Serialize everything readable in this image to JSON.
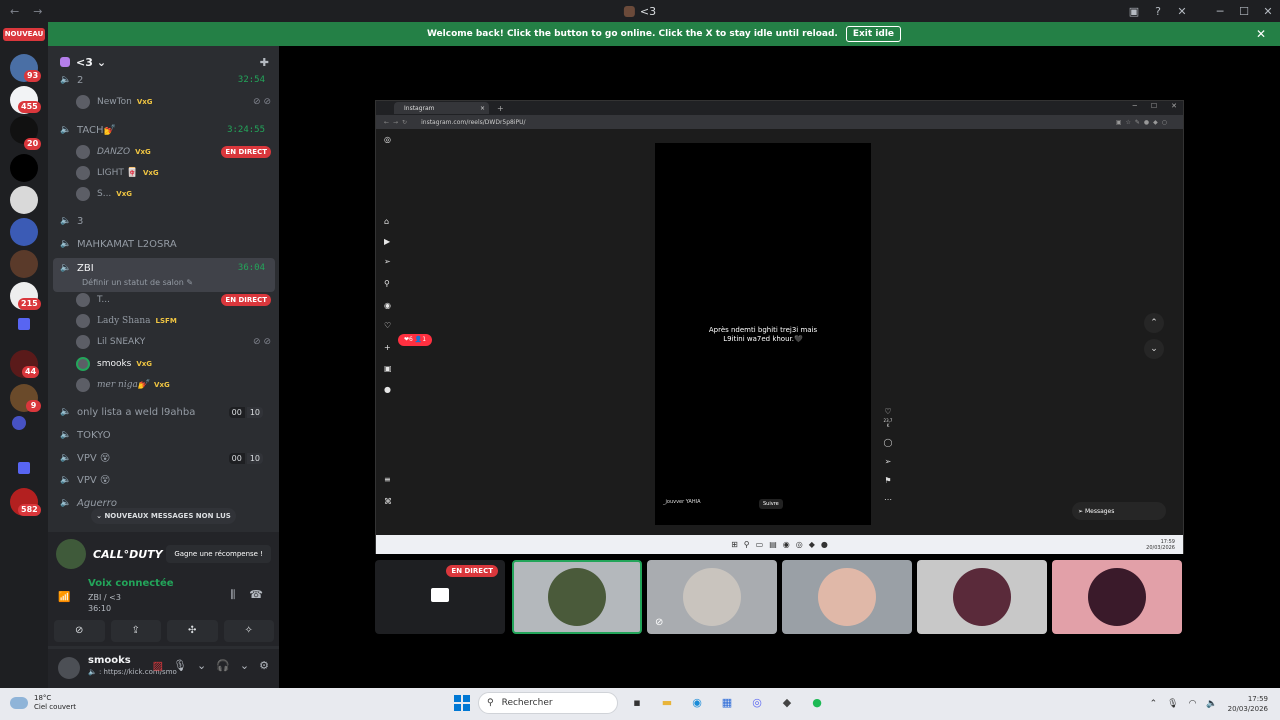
{
  "titlebar": {
    "back": "←",
    "forward": "→",
    "title": "<3",
    "icons": [
      "cast-icon",
      "help-icon",
      "tools-icon"
    ],
    "minimize": "─",
    "maximize": "☐",
    "close": "✕"
  },
  "banner": {
    "text": "Welcome back! Click the button to go online. Click the X to stay idle until reload.",
    "button": "Exit idle",
    "close": "✕"
  },
  "serverbar": {
    "nouveau": "NOUVEAU",
    "badges": [
      "93",
      "455",
      "20",
      "215",
      "44",
      "9",
      "582"
    ]
  },
  "server": {
    "name": "<3",
    "chevron": "⌄"
  },
  "channels": {
    "c1": {
      "name": "2",
      "time": "32:54"
    },
    "u_newton": {
      "name": "NewTon",
      "tag": "VxG"
    },
    "c_tach": {
      "name": "TACH💅",
      "time": "3:24:55"
    },
    "u_danzo": {
      "name": "DANZO",
      "tag": "VxG",
      "live": "EN DIRECT"
    },
    "u_light": {
      "name": "LIGHT 🀄",
      "tag": "VxG"
    },
    "u_s": {
      "name": "S...",
      "tag": "VxG"
    },
    "c3": {
      "name": "3"
    },
    "c_mahk": {
      "name": "MAHKAMAT L2OSRA"
    },
    "c_zbi": {
      "name": "ZBI",
      "time": "36:04",
      "status": "Définir un statut de salon ✎"
    },
    "u_t": {
      "name": "T...",
      "live": "EN DIRECT"
    },
    "u_lady": {
      "name": "Lady Shana",
      "tag": "LSFM"
    },
    "u_lil": {
      "name": "Lil SNEAKY"
    },
    "u_smooks": {
      "name": "smooks",
      "tag": "VxG"
    },
    "u_mer": {
      "name": "mer nigа💅",
      "tag": "VxG"
    },
    "c_only": {
      "name": "only lista a weld l9ahba",
      "a": "00",
      "b": "10"
    },
    "c_tokyo": {
      "name": "TOKYO"
    },
    "c_vpv1": {
      "name": "VPV 😵",
      "a": "00",
      "b": "10"
    },
    "c_vpv2": {
      "name": "VPV 😵"
    },
    "c_ague": {
      "name": "Aguerro"
    }
  },
  "unread": "⌄ NOUVEAUX MESSAGES NON LUS",
  "promo": {
    "game": "CALL°DUTY",
    "reward": "Gagne une récompense !"
  },
  "voice": {
    "status": "Voix connectée",
    "channel": "ZBI / <3",
    "time": "36:10"
  },
  "user": {
    "name": "smooks",
    "status": "🔈 : https://kick.com/smo"
  },
  "browser": {
    "tab": "Instagram",
    "url": "instagram.com/reels/DWDr5p8iPU/",
    "caption_line1": "Après ndemti bghiti trej3i mais",
    "caption_line2": "L9itini wa7ed khour.🖤",
    "account": "_jouvver  YAHIA",
    "follow": "Suivre",
    "likes": "23,7 K",
    "notif": "❤6 👤1",
    "messages": "Messages",
    "clock_time": "17:59",
    "clock_date": "20/03/2026"
  },
  "tiles": {
    "live": "EN DIRECT"
  },
  "taskbar": {
    "temp": "18°C",
    "weather": "Ciel couvert",
    "search": "Rechercher",
    "time": "17:59",
    "date": "20/03/2026"
  }
}
